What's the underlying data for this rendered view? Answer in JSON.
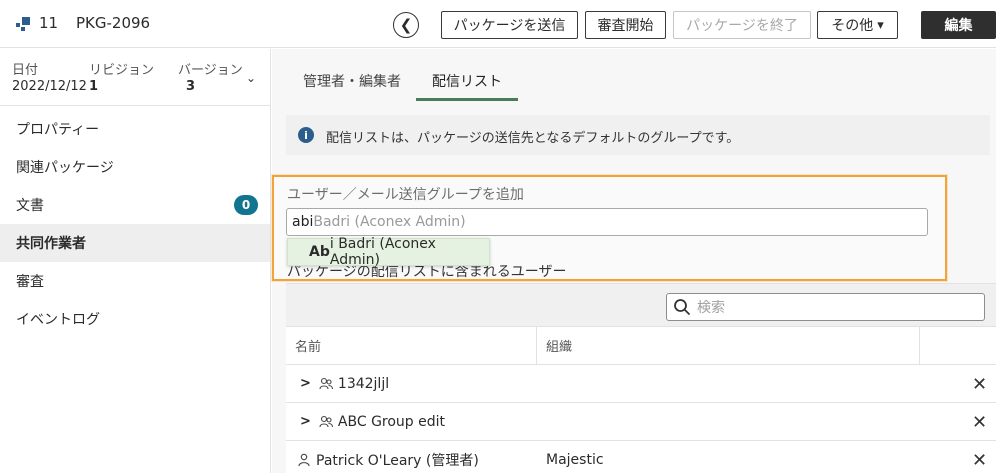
{
  "header": {
    "count": "11",
    "package_id": "PKG-2096",
    "back_label": "❮",
    "buttons": {
      "send": "パッケージを送信",
      "review": "審査開始",
      "close": "パッケージを終了",
      "more": "その他",
      "more_caret": "▾",
      "edit": "編集"
    }
  },
  "meta": {
    "date_label": "日付",
    "date_value": "2022/12/12",
    "revision_label": "リビジョン",
    "revision_value": "1",
    "version_label": "バージョン",
    "version_value": "3",
    "toggle": "⌄"
  },
  "sidebar": {
    "items": [
      {
        "label": "プロパティー"
      },
      {
        "label": "関連パッケージ"
      },
      {
        "label": "文書",
        "badge": "0"
      },
      {
        "label": "共同作業者"
      },
      {
        "label": "審査"
      },
      {
        "label": "イベントログ"
      }
    ]
  },
  "tabs": [
    {
      "label": "管理者・編集者"
    },
    {
      "label": "配信リスト"
    }
  ],
  "info": {
    "icon": "i",
    "text": "配信リストは、パッケージの送信先となるデフォルトのグループです。"
  },
  "add": {
    "label": "ユーザー／メール送信グループを追加",
    "typed": "abi",
    "completion": " Badri (Aconex Admin)",
    "suggestion_match": "Ab",
    "suggestion_rest": "i Badri (Aconex Admin)",
    "members_label": "パッケージの配信リストに含まれるユーザー"
  },
  "table": {
    "search_placeholder": "検索",
    "headers": [
      "名前",
      "組織"
    ],
    "rows": [
      {
        "name": "1342jljl",
        "org": "",
        "expandable": true,
        "type": "group"
      },
      {
        "name": "ABC Group edit",
        "org": "",
        "expandable": true,
        "type": "group"
      },
      {
        "name": "Patrick O'Leary (管理者)",
        "org": "Majestic",
        "expandable": false,
        "type": "user"
      }
    ],
    "remove_symbol": "✕"
  },
  "colors": {
    "accent_tab": "#4a7c59",
    "badge": "#11758f",
    "highlight": "#f2a33a",
    "suggestion_bg": "#e5f2e1"
  }
}
